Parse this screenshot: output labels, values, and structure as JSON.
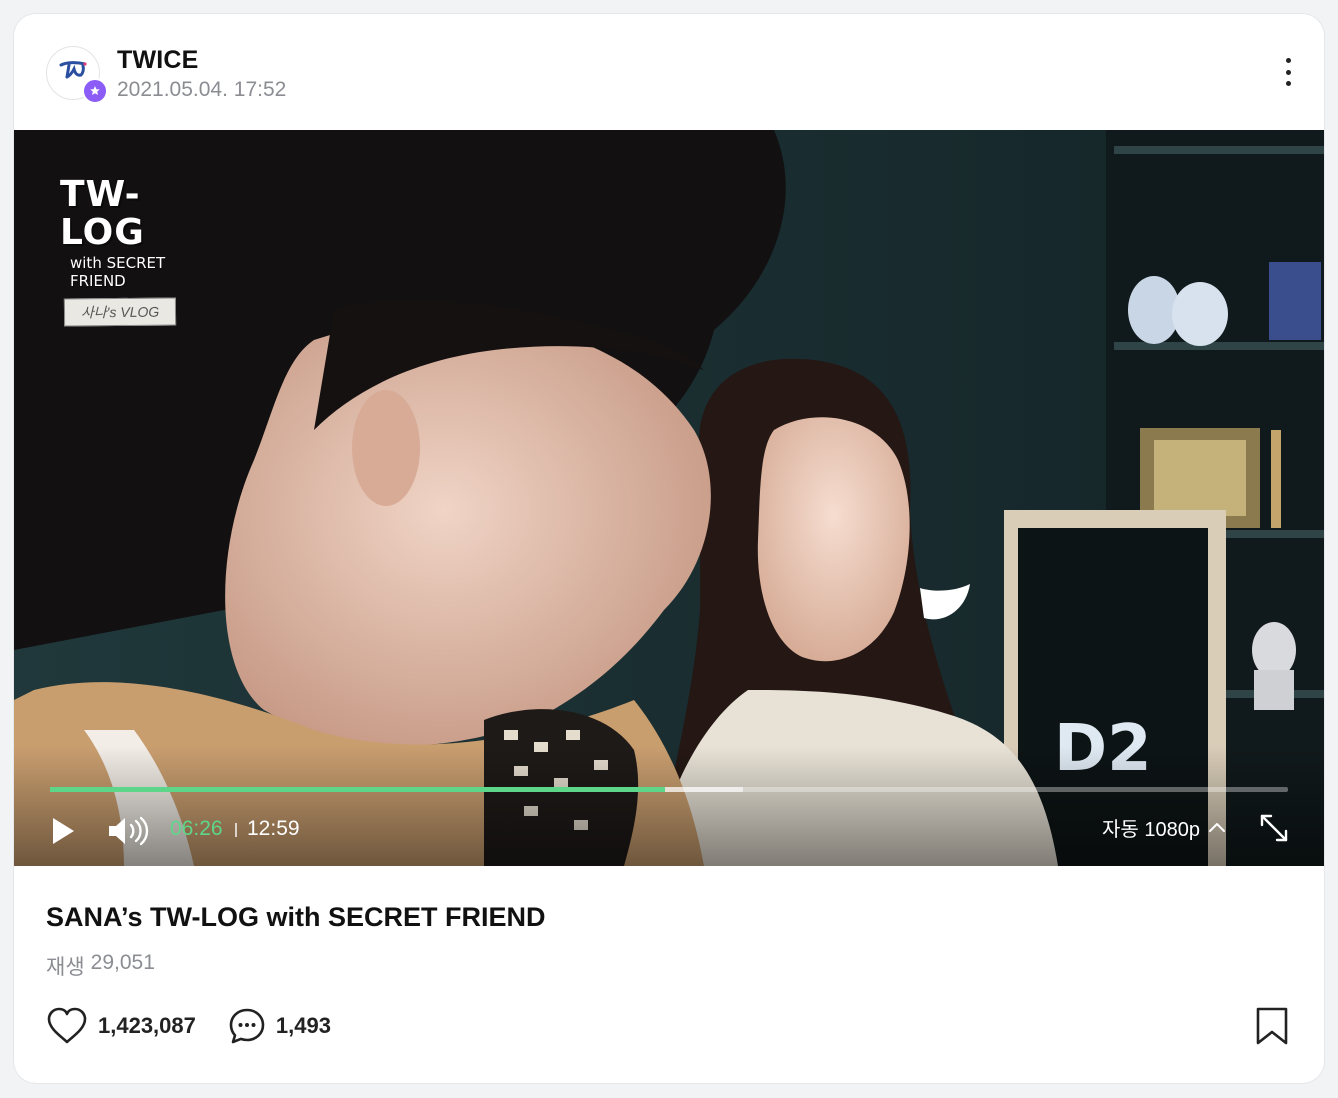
{
  "post": {
    "author": "TWICE",
    "date": "2021.05.04. 17:52",
    "avatar_logo_text": "TWICE",
    "avatar_badge_icon": "star-badge-icon",
    "more_icon": "more-vertical-icon"
  },
  "video": {
    "overlay_logo": {
      "title": "TW-LOG",
      "subtitle": "with SECRET FRIEND",
      "tag": "사나's VLOG"
    },
    "progress": {
      "played_fraction": 0.497,
      "buffered_fraction": 0.56
    },
    "time_current": "06:26",
    "time_total": "12:59",
    "quality_label": "자동 1080p",
    "icons": {
      "play": "play-icon",
      "volume": "volume-icon",
      "quality_chevron": "chevron-up-icon",
      "fullscreen": "expand-icon"
    },
    "accent_color": "#5dd68a"
  },
  "info": {
    "title": "SANA’s TW-LOG with SECRET FRIEND",
    "views_label": "재생",
    "views_count": "29,051"
  },
  "actions": {
    "likes": "1,423,087",
    "comments": "1,493",
    "icons": {
      "like": "heart-icon",
      "comment": "comment-bubble-icon",
      "bookmark": "bookmark-icon"
    }
  },
  "colors": {
    "badge": "#8b5cf6",
    "muted_text": "#8b8d93"
  }
}
